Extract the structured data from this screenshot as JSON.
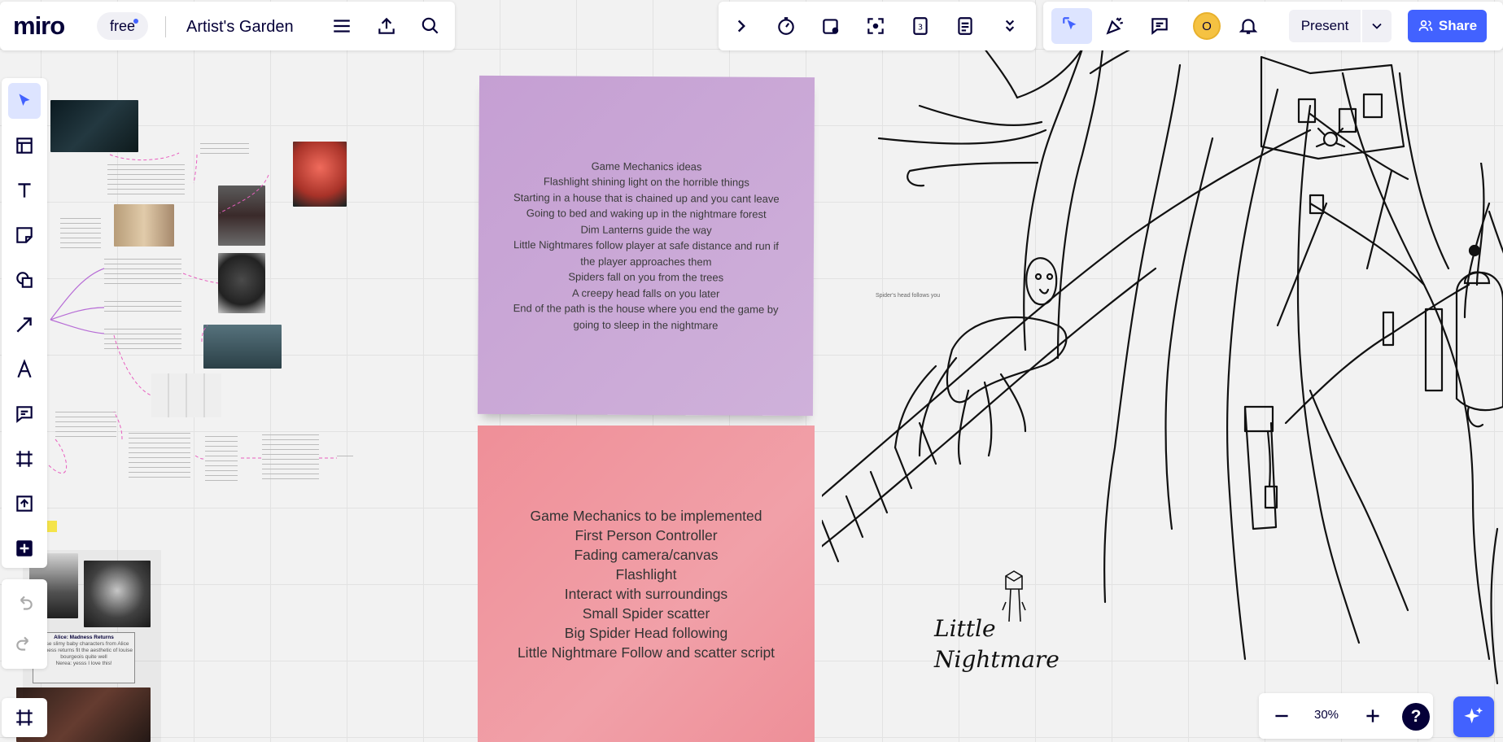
{
  "app": {
    "logo": "miro",
    "plan_badge": "free",
    "board_title": "Artist's Garden"
  },
  "topbar": {
    "present_label": "Present",
    "share_label": "Share",
    "avatar_initial": "O"
  },
  "sticky_purple": {
    "lines": [
      "Game Mechanics ideas",
      "Flashlight shining light on the horrible things",
      "Starting in a house that is chained up and you cant leave",
      "Going to bed and waking up in the nightmare forest",
      "Dim Lanterns guide the way",
      "Little Nightmares follow player at safe distance and run if the player approaches them",
      "Spiders fall on you from the trees",
      "A creepy head falls on you later",
      "End of the path is the house  where you end the game by going to sleep in the nightmare"
    ]
  },
  "sticky_pink": {
    "lines": [
      "Game Mechanics to be implemented",
      "First Person Controller",
      "Fading camera/canvas",
      "Flashlight",
      "Interact with surroundings",
      "Small Spider scatter",
      "Big Spider Head following",
      "Little Nightmare Follow and scatter script"
    ]
  },
  "sketch": {
    "spider_caption": "Spider's head follows you",
    "nightmare_label_1": "Little",
    "nightmare_label_2": "Nightmare"
  },
  "reference_card": {
    "title": "Alice: Madness Returns",
    "body": "these slimy baby characters from Alice madness returns fit the aesthetic of louise bourgeois quite well",
    "reply": "Nerea: yesss I love this!"
  },
  "zoom": {
    "level": "30%"
  },
  "colors": {
    "accent": "#4262ff",
    "sticky_purple": "#c9a8d8",
    "sticky_pink": "#f1929a",
    "avatar": "#f5c242"
  }
}
